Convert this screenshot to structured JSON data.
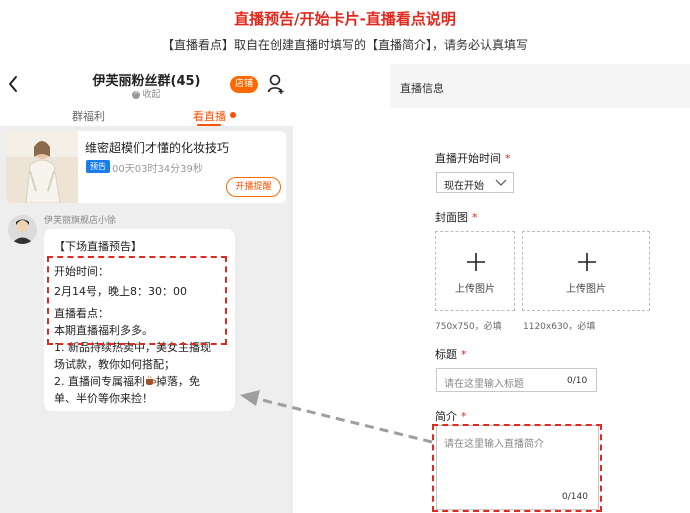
{
  "header": {
    "title": "直播预告/开始卡片-直播看点说明",
    "subtitle": "【直播看点】取自在创建直播时填写的【直播简介】，请务必认真填写"
  },
  "phone": {
    "group_name": "伊芙丽粉丝群(45)",
    "collect_label": "收起",
    "shop_badge": "店铺",
    "tabs": [
      {
        "label": "群福利",
        "active": false
      },
      {
        "label": "看直播",
        "active": true
      }
    ],
    "live_card": {
      "title": "维密超模们才懂的化妆技巧",
      "tag": "预告",
      "countdown": "00天03时34分39秒",
      "remind_button": "开播提醒"
    },
    "message": {
      "sender": "伊芙丽旗舰店小徐",
      "heading": "【下场直播预告】",
      "start_label": "开始时间：",
      "start_value": "2月14号，晚上8：30：00",
      "highlights_label": "直播看点：",
      "highlights_lines": [
        "本期直播福利多多。",
        "1. 新品持续热卖中，美女主播现",
        "场试款，教你如何搭配；",
        "2. 直播间专属福利",
        "掉落，免",
        "单、半价等你来捡！"
      ]
    }
  },
  "form": {
    "section_title": "直播信息",
    "start_time": {
      "label": "直播开始时间",
      "value": "现在开始"
    },
    "cover": {
      "label": "封面图",
      "upload_label_1": "上传图片",
      "upload_label_2": "上传图片",
      "hint_1": "750x750，必填",
      "hint_2": "1120x630，必填"
    },
    "title_field": {
      "label": "标题",
      "placeholder": "请在这里输入标题",
      "counter": "0/10"
    },
    "intro_field": {
      "label": "简介",
      "placeholder": "请在这里输入直播简介",
      "counter": "0/140"
    },
    "required_mark": "*"
  },
  "colors": {
    "accent": "#e02a1f",
    "orange": "#ff5000",
    "tag_blue": "#1a7de8"
  }
}
